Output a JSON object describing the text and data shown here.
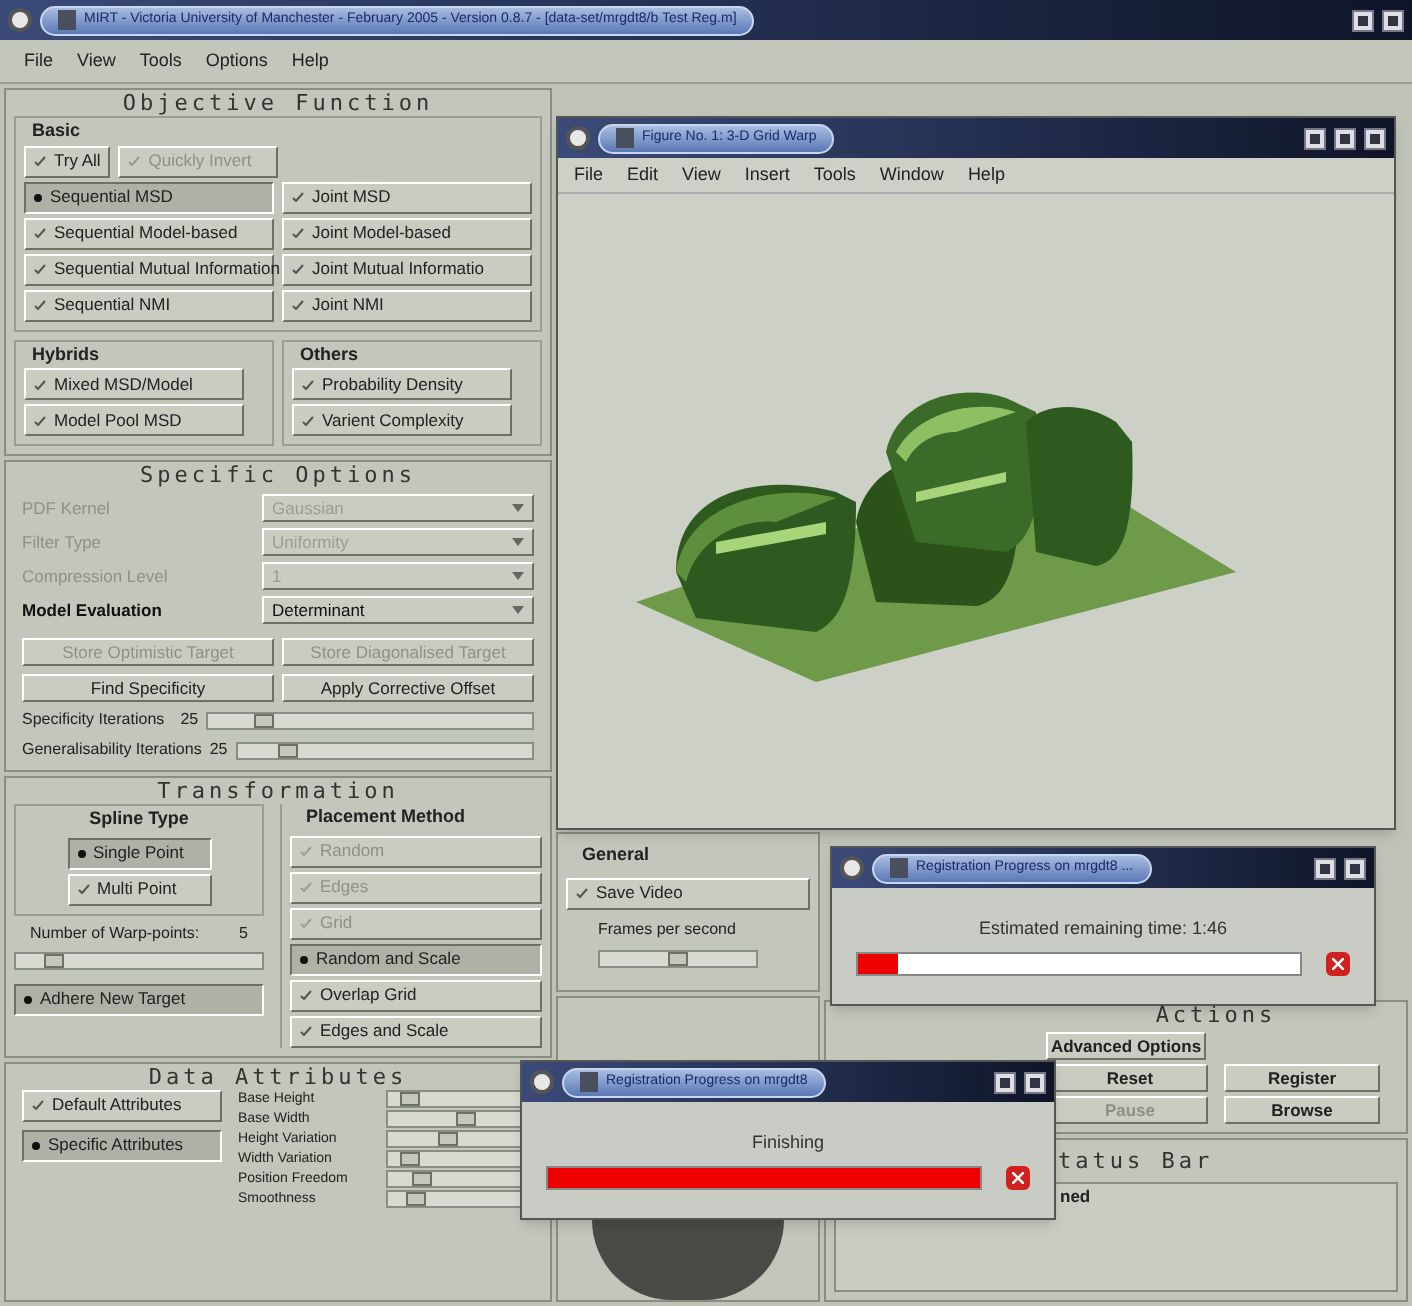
{
  "main_window": {
    "title": "MIRT - Victoria University of Manchester - February 2005 - Version 0.8.7 - [data-set/mrgdt8/b Test Reg.m]",
    "menu": [
      "File",
      "View",
      "Tools",
      "Options",
      "Help"
    ]
  },
  "objective_function": {
    "title": "Objective Function",
    "basic": {
      "title": "Basic",
      "top": [
        {
          "label": "Try All",
          "selected": false,
          "disabled": false
        },
        {
          "label": "Quickly Invert",
          "selected": false,
          "disabled": true
        }
      ],
      "left": [
        {
          "label": "Sequential MSD",
          "selected": true,
          "disabled": false
        },
        {
          "label": "Sequential Model-based",
          "selected": false,
          "disabled": false
        },
        {
          "label": "Sequential Mutual Information",
          "selected": false,
          "disabled": false
        },
        {
          "label": "Sequential NMI",
          "selected": false,
          "disabled": false
        }
      ],
      "right": [
        {
          "label": "Joint MSD",
          "selected": false,
          "disabled": false
        },
        {
          "label": "Joint Model-based",
          "selected": false,
          "disabled": false
        },
        {
          "label": "Joint Mutual Informatio",
          "selected": false,
          "disabled": false
        },
        {
          "label": "Joint NMI",
          "selected": false,
          "disabled": false
        }
      ]
    },
    "hybrids": {
      "title": "Hybrids",
      "items": [
        {
          "label": "Mixed MSD/Model",
          "selected": false,
          "disabled": false
        },
        {
          "label": "Model Pool MSD",
          "selected": false,
          "disabled": false
        }
      ]
    },
    "others": {
      "title": "Others",
      "items": [
        {
          "label": "Probability Density",
          "selected": false,
          "disabled": false
        },
        {
          "label": "Varient Complexity",
          "selected": false,
          "disabled": false
        }
      ]
    }
  },
  "specific_options": {
    "title": "Specific Options",
    "fields": [
      {
        "label": "PDF Kernel",
        "value": "Gaussian",
        "disabled": true
      },
      {
        "label": "Filter Type",
        "value": "Uniformity",
        "disabled": true
      },
      {
        "label": "Compression Level",
        "value": "1",
        "disabled": true
      },
      {
        "label": "Model Evaluation",
        "value": "Determinant",
        "disabled": false
      }
    ],
    "buttons": [
      {
        "label": "Store Optimistic Target",
        "disabled": true
      },
      {
        "label": "Store Diagonalised Target",
        "disabled": true
      },
      {
        "label": "Find Specificity",
        "disabled": false
      },
      {
        "label": "Apply Corrective Offset",
        "disabled": false
      }
    ],
    "sliders": [
      {
        "label": "Specificity Iterations",
        "value": "25",
        "level": 0.15
      },
      {
        "label": "Generalisability Iterations",
        "value": "25",
        "level": 0.15
      }
    ]
  },
  "transformation": {
    "title": "Transformation",
    "spline_type": {
      "title": "Spline Type",
      "items": [
        {
          "label": "Single Point",
          "selected": true,
          "disabled": false
        },
        {
          "label": "Multi Point",
          "selected": false,
          "disabled": false
        }
      ]
    },
    "warp_points": {
      "label": "Number of Warp-points:",
      "value": "5",
      "level": 0.12
    },
    "adhere": {
      "label": "Adhere New Target",
      "selected": true,
      "disabled": false
    },
    "placement_method": {
      "title": "Placement Method",
      "items": [
        {
          "label": "Random",
          "selected": false,
          "disabled": true
        },
        {
          "label": "Edges",
          "selected": false,
          "disabled": true
        },
        {
          "label": "Grid",
          "selected": false,
          "disabled": true
        },
        {
          "label": "Random and Scale",
          "selected": true,
          "disabled": false
        },
        {
          "label": "Overlap Grid",
          "selected": false,
          "disabled": false
        },
        {
          "label": "Edges and Scale",
          "selected": false,
          "disabled": false
        }
      ]
    }
  },
  "data_attributes": {
    "title": "Data Attributes",
    "items": [
      {
        "label": "Default Attributes",
        "selected": false,
        "disabled": false
      },
      {
        "label": "Specific Attributes",
        "selected": true,
        "disabled": false
      }
    ],
    "sliders": [
      {
        "label": "Base Height",
        "level": 0.1
      },
      {
        "label": "Base Width",
        "level": 0.55
      },
      {
        "label": "Height Variation",
        "level": 0.4
      },
      {
        "label": "Width Variation",
        "level": 0.1
      },
      {
        "label": "Position Freedom",
        "level": 0.2
      },
      {
        "label": "Smoothness",
        "level": 0.15
      }
    ]
  },
  "general": {
    "title": "General",
    "save_video": {
      "label": "Save Video",
      "selected": false,
      "disabled": false
    },
    "frames": {
      "label": "Frames per second",
      "level": 0.5
    }
  },
  "actions": {
    "title": "Actions",
    "buttons": [
      {
        "label": "Advanced Options",
        "disabled": false
      },
      {
        "label": "Reset",
        "disabled": false
      },
      {
        "label": "Register",
        "disabled": false
      },
      {
        "label": "Pause",
        "disabled": true
      },
      {
        "label": "Browse",
        "disabled": false
      }
    ]
  },
  "status_bar": {
    "title": "tatus Bar",
    "text": "ned"
  },
  "figure_window": {
    "title": "Figure No. 1: 3-D Grid Warp",
    "menu": [
      "File",
      "Edit",
      "View",
      "Insert",
      "Tools",
      "Window",
      "Help"
    ]
  },
  "progress_dialogs": [
    {
      "title": "Registration Progress on mrgdt8 ...",
      "message": "Estimated remaining time: 1:46",
      "level": 0.09
    },
    {
      "title": "Registration Progress on mrgdt8",
      "message": "Finishing",
      "level": 1
    }
  ]
}
